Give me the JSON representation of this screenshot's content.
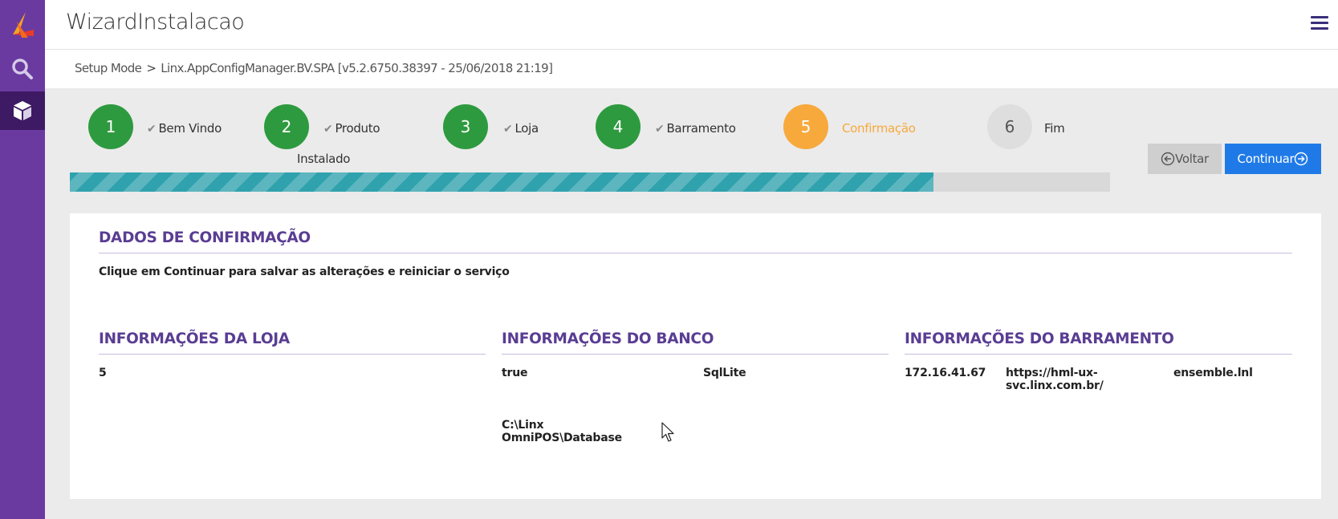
{
  "app": {
    "title": "WizardInstalacao"
  },
  "sidebar": {
    "items": [
      "logo-icon",
      "search-icon",
      "cube-icon"
    ]
  },
  "breadcrumb": {
    "root": "Setup Mode",
    "separator": ">",
    "current": "Linx.AppConfigManager.BV.SPA [v5.2.6750.38397 - 25/06/2018 21:19]"
  },
  "steps": [
    {
      "number": "1",
      "label": "Bem Vindo",
      "status": "done"
    },
    {
      "number": "2",
      "label": "Produto",
      "label2": "Instalado",
      "status": "done"
    },
    {
      "number": "3",
      "label": "Loja",
      "status": "done"
    },
    {
      "number": "4",
      "label": "Barramento",
      "status": "done"
    },
    {
      "number": "5",
      "label": "Confirmação",
      "status": "active"
    },
    {
      "number": "6",
      "label": "Fim",
      "status": "pending"
    }
  ],
  "progress": {
    "percent": 83
  },
  "buttons": {
    "back": "Voltar",
    "next": "Continuar"
  },
  "confirmation": {
    "title": "DADOS DE CONFIRMAÇÃO",
    "message": "Clique em Continuar para salvar as alterações e reiniciar o serviço"
  },
  "store_info": {
    "title": "INFORMAÇÕES DA LOJA",
    "value": "5"
  },
  "db_info": {
    "title": "INFORMAÇÕES DO BANCO",
    "enabled": "true",
    "provider": "SqlLite",
    "path_line1": "C:\\Linx",
    "path_line2": "OmniPOS\\Database"
  },
  "bus_info": {
    "title": "INFORMAÇÕES DO BARRAMENTO",
    "ip": "172.16.41.67",
    "url_line1": "https://hml-ux-",
    "url_line2": "svc.linx.com.br/",
    "name": "ensemble.lnl"
  },
  "colors": {
    "sidebar": "#6a3aa0",
    "step_done": "#2e9a3f",
    "step_active": "#f7a93c",
    "progress": "#2fa2ad",
    "primary_button": "#1f7ae8",
    "section_title": "#5a3d93"
  }
}
